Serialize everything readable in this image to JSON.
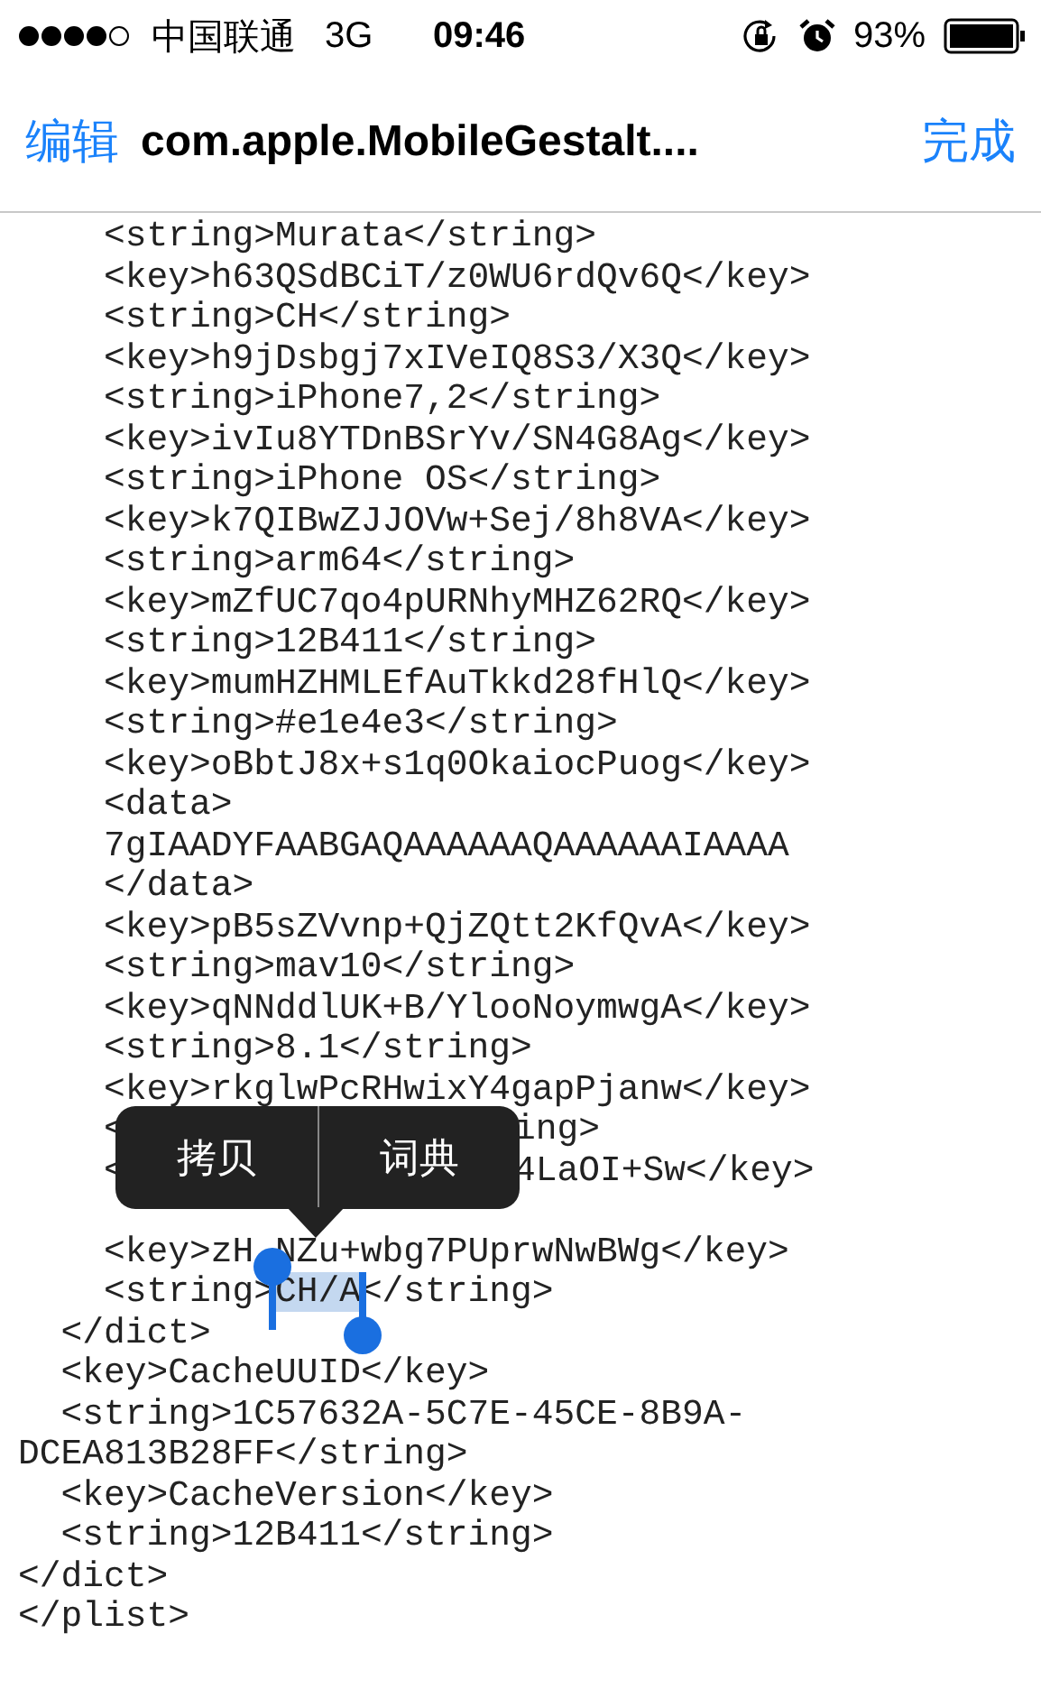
{
  "status_bar": {
    "carrier": "中国联通",
    "network": "3G",
    "time": "09:46",
    "battery": "93%"
  },
  "nav": {
    "left": "编辑",
    "title": "com.apple.MobileGestalt....",
    "right": "完成"
  },
  "xml": [
    {
      "children": [
        {
          "children": [
            {
              "kind": "text",
              "text": "<string>Murata</string>"
            },
            {
              "kind": "text",
              "text": "<key>h63QSdBCiT/z0WU6rdQv6Q</key>"
            },
            {
              "kind": "text",
              "text": "<string>CH</string>"
            },
            {
              "kind": "text",
              "text": "<key>h9jDsbgj7xIVeIQ8S3/X3Q</key>"
            },
            {
              "kind": "text",
              "text": "<string>iPhone7,2</string>"
            },
            {
              "kind": "text",
              "text": "<key>ivIu8YTDnBSrYv/SN4G8Ag</key>"
            },
            {
              "kind": "text",
              "text": "<string>iPhone OS</string>"
            },
            {
              "kind": "text",
              "text": "<key>k7QIBwZJJOVw+Sej/8h8VA</key>"
            },
            {
              "kind": "text",
              "text": "<string>arm64</string>"
            },
            {
              "kind": "text",
              "text": "<key>mZfUC7qo4pURNhyMHZ62RQ</key>"
            },
            {
              "kind": "text",
              "text": "<string>12B411</string>"
            },
            {
              "kind": "text",
              "text": "<key>mumHZHMLEfAuTkkd28fHlQ</key>"
            },
            {
              "kind": "text",
              "text": "<string>#e1e4e3</string>"
            },
            {
              "kind": "text",
              "text": "<key>oBbtJ8x+s1q0OkaiocPuog</key>"
            },
            {
              "kind": "text",
              "text": "<data>"
            },
            {
              "kind": "text",
              "text": "7gIAADYFAABGAQAAAAAAQAAAAAAIAAAA"
            },
            {
              "kind": "text",
              "text": "</data>"
            },
            {
              "kind": "text",
              "text": "<key>pB5sZVvnp+QjZQtt2KfQvA</key>"
            },
            {
              "kind": "text",
              "text": "<string>mav10</string>"
            },
            {
              "kind": "text",
              "text": "<key>qNNddlUK+B/YlooNoymwgA</key>"
            },
            {
              "kind": "text",
              "text": "<string>8.1</string>"
            },
            {
              "kind": "text",
              "text": "<key>rkglwPcRHwixY4gapPjanw</key>"
            },
            {
              "kind": "covered",
              "parts": [
                "<",
                "ing>"
              ]
            },
            {
              "kind": "covered",
              "parts": [
                "<",
                "4LaOI+Sw</key>"
              ]
            },
            {
              "kind": "hidden"
            },
            {
              "kind": "gap",
              "parts": [
                "<key>zH",
                "NZu+wbg7PUprwNwBWg</key>"
              ]
            },
            {
              "kind": "selection",
              "before": "<string>",
              "selected": "CH/A",
              "after": "</string>"
            }
          ]
        },
        {
          "kind": "text",
          "text": "</dict>"
        },
        {
          "kind": "text",
          "text": "<key>CacheUUID</key>"
        },
        {
          "kind": "text",
          "text": "<string>1C57632A-5C7E-45CE-8B9A-DCEA813B28FF</string>"
        },
        {
          "kind": "text",
          "text": "<key>CacheVersion</key>"
        },
        {
          "kind": "text",
          "text": "<string>12B411</string>"
        }
      ]
    },
    {
      "kind": "text",
      "text": "</dict>"
    },
    {
      "kind": "text",
      "text": "</plist>"
    }
  ],
  "menu": {
    "items": [
      {
        "label": "拷贝"
      },
      {
        "label": "词典"
      }
    ]
  }
}
